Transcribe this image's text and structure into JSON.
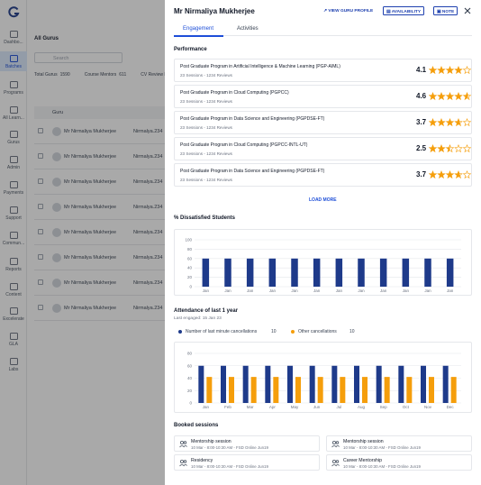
{
  "nav": {
    "items": [
      {
        "label": "Dashbo..."
      },
      {
        "label": "Batches"
      },
      {
        "label": "Programs"
      },
      {
        "label": "All Learn..."
      },
      {
        "label": "Gurus"
      },
      {
        "label": "Admin"
      },
      {
        "label": "Payments"
      },
      {
        "label": "Support"
      },
      {
        "label": "Commun..."
      },
      {
        "label": "Reports"
      },
      {
        "label": "Content"
      },
      {
        "label": "Excelerate"
      },
      {
        "label": "GLA"
      },
      {
        "label": "Labs"
      }
    ]
  },
  "background": {
    "title": "All Gurus",
    "search_placeholder": "Search",
    "stats": [
      {
        "label": "Total Gurus",
        "value": "1590"
      },
      {
        "label": "Course Mentors",
        "value": "611"
      },
      {
        "label": "CV Review Mentors",
        "value": "12"
      },
      {
        "label": "Evaluators",
        "value": "2"
      },
      {
        "label": "Content Creator",
        "value": ""
      }
    ],
    "column_header": "Guru",
    "rows": [
      {
        "name": "Mr Nirmaliya Mukherjee",
        "email": "Nirmalya.234"
      },
      {
        "name": "Mr Nirmaliya Mukherjee",
        "email": "Nirmalya.234"
      },
      {
        "name": "Mr Nirmaliya Mukherjee",
        "email": "Nirmalya.234"
      },
      {
        "name": "Mr Nirmaliya Mukherjee",
        "email": "Nirmalya.234"
      },
      {
        "name": "Mr Nirmaliya Mukherjee",
        "email": "Nirmalya.234"
      },
      {
        "name": "Mr Nirmaliya Mukherjee",
        "email": "Nirmalya.234"
      },
      {
        "name": "Mr Nirmaliya Mukherjee",
        "email": "Nirmalya.234"
      },
      {
        "name": "Mr Nirmaliya Mukherjee",
        "email": "Nirmalya.234"
      }
    ]
  },
  "drawer": {
    "title": "Mr Nirmaliya Mukherjee",
    "view_profile": "VIEW GURU PROFILE",
    "availability": "AVAILABILITY",
    "note": "NOTE",
    "tabs": [
      "Engagement",
      "Activities"
    ],
    "performance_title": "Performance",
    "programs": [
      {
        "name": "Post Graduate Program in Artificial Intelligence & Machine Learning (PGP-AIML)",
        "meta": "23 Sessions - 1234 Reviews",
        "rating": "4.1"
      },
      {
        "name": "Post Graduate Program in Cloud Computing (PGPCC)",
        "meta": "23 Sessions - 1234 Reviews",
        "rating": "4.6"
      },
      {
        "name": "Post Graduate Program in Data Science and Engineering (PGPDSE-FT)",
        "meta": "23 Sessions - 1234 Reviews",
        "rating": "3.7"
      },
      {
        "name": "Post Graduate Program in Cloud Computing (PGPCC-INTL-UT)",
        "meta": "23 Sessions - 1234 Reviews",
        "rating": "2.5"
      },
      {
        "name": "Post Graduate Program in Data Science and Engineering (PGPDSE-FT)",
        "meta": "23 Sessions - 1234 Reviews",
        "rating": "3.7"
      }
    ],
    "load_more": "LOAD MORE",
    "dissatisfied_title": "% Dissatisfied Students",
    "attendance_title": "Attendance of last 1 year",
    "last_engaged": "Last engaged: 15 Jan 23",
    "legend": {
      "last_minute_label": "Number of last minute cancellations",
      "last_minute_value": "10",
      "other_label": "Other cancellations",
      "other_value": "10"
    },
    "booked_title": "Booked sessions",
    "sessions": [
      {
        "name": "Mentorship session",
        "detail": "10 Mar - 8:00-10:30 AM - FSD Online Jun19"
      },
      {
        "name": "Mentorship session",
        "detail": "10 Mar - 8:00-10:30 AM - FSD Online Jun19"
      },
      {
        "name": "Residency",
        "detail": "10 Mar - 8:00-10:30 AM - FSD Online Jun19"
      },
      {
        "name": "Career Mentorship",
        "detail": "10 Mar - 8:00-10:30 AM - FSD Online Jun19"
      }
    ]
  },
  "colors": {
    "primary": "#1e3a8a",
    "secondary": "#f59e0b",
    "star": "#f59e0b"
  },
  "chart_data": [
    {
      "type": "bar",
      "title": "% Dissatisfied Students",
      "categories": [
        "Jan",
        "Jan",
        "Jan",
        "Jan",
        "Jan",
        "Jan",
        "Jan",
        "Jan",
        "Jan",
        "Jan",
        "Jan",
        "Jan"
      ],
      "values": [
        60,
        60,
        60,
        60,
        60,
        60,
        60,
        60,
        60,
        60,
        60,
        60
      ],
      "ylim": [
        0,
        100
      ],
      "yticks": [
        "100",
        "80",
        "60",
        "40",
        "20",
        "0"
      ],
      "grid": true
    },
    {
      "type": "bar",
      "title": "Attendance of last 1 year",
      "categories": [
        "Jan",
        "Feb",
        "Mar",
        "Apr",
        "May",
        "Jun",
        "Jul",
        "Aug",
        "Sep",
        "Oct",
        "Nov",
        "Dec"
      ],
      "series": [
        {
          "name": "Number of last minute cancellations",
          "values": [
            60,
            60,
            60,
            60,
            60,
            60,
            60,
            60,
            60,
            60,
            60,
            60
          ]
        },
        {
          "name": "Other cancellations",
          "values": [
            42,
            42,
            42,
            42,
            42,
            42,
            42,
            42,
            42,
            42,
            42,
            42
          ]
        }
      ],
      "ylim": [
        0,
        80
      ],
      "yticks": [
        "80",
        "60",
        "40",
        "20",
        "0"
      ],
      "grid": true
    }
  ]
}
